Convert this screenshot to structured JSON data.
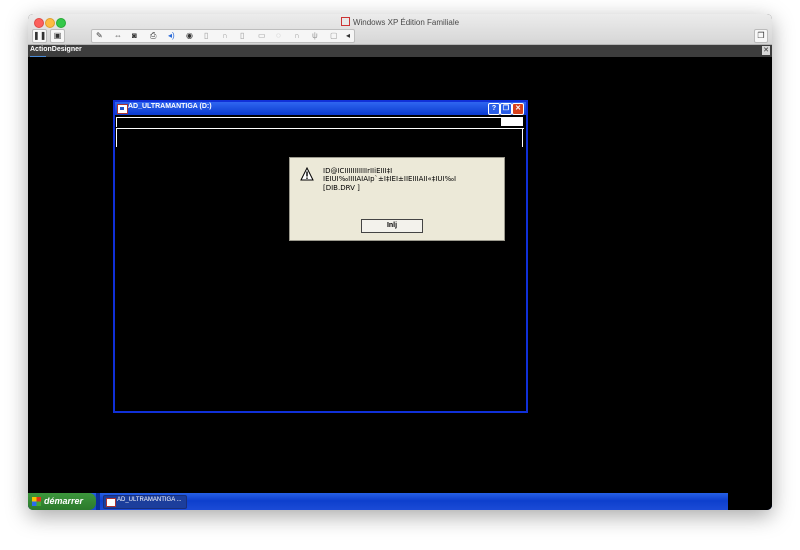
{
  "host": {
    "window_title": "Windows XP Édition Familiale",
    "vm_tab": "ActionDesigner",
    "toolbar_icons": [
      "pause-icon",
      "snapshot-icon",
      "wrench-icon",
      "arrows-icon",
      "disk-icon",
      "printer-icon",
      "sound-icon",
      "record-icon",
      "usb-icon",
      "phone-icon",
      "headset-icon",
      "folder-icon",
      "cd-icon",
      "camera-icon",
      "usb2-icon",
      "fullscreen-icon",
      "chevron-left-icon",
      "window-icon"
    ],
    "colors": {
      "close": "#fc605c",
      "minimize": "#fdbc40",
      "zoom": "#34c84a"
    }
  },
  "guest": {
    "window": {
      "title": "AD_ULTRAMANTIGA (D:)"
    },
    "dialog": {
      "message_line1": "ID@ICIIIIIIIIIIIrIIiEIII‡I  IEIUI‰IIIIAIAIp`±I‡IEI±IIEIIIAII«‡IUI‰I",
      "message_line2": "[DIB.DRV  ]",
      "button_label": "Inlj"
    },
    "taskbar": {
      "start_label": "démarrer",
      "task_label": "AD_ULTRAMANTIGA ..."
    }
  }
}
